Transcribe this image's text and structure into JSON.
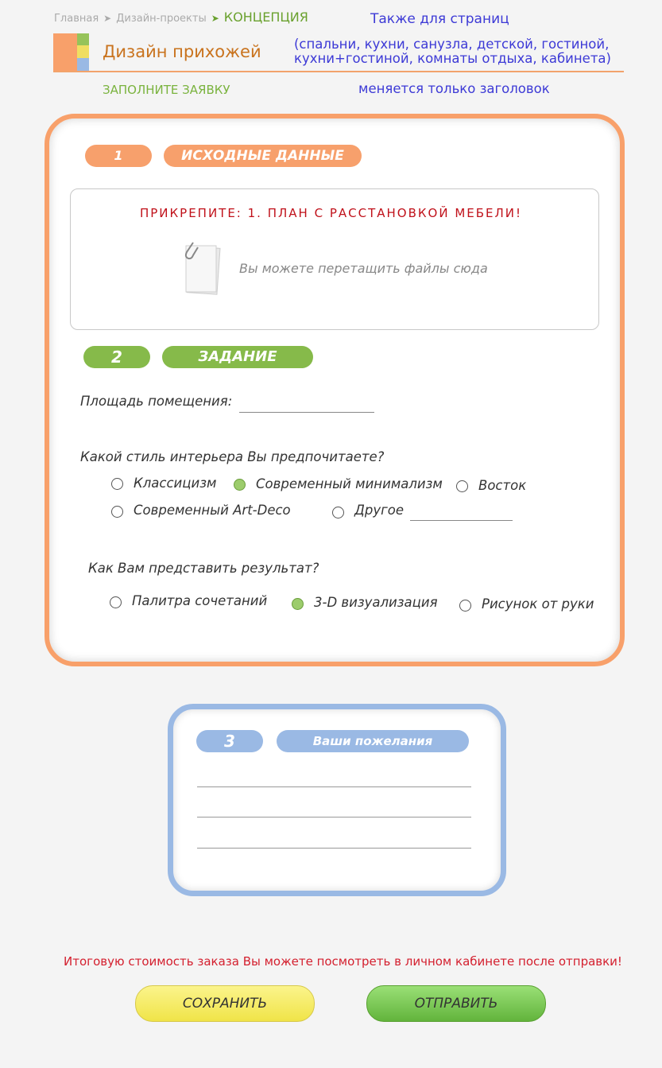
{
  "breadcrumb": {
    "home": "Главная",
    "projects": "Дизайн-проекты",
    "current": "КОНЦЕПЦИЯ"
  },
  "header": {
    "also_for": "Также для страниц",
    "title": "Дизайн прихожей",
    "rooms_line1": "(спальни, кухни, санузла, детской, гостиной,",
    "rooms_line2": "кухни+гостиной, комнаты отдыха, кабинета)",
    "fill_request": "ЗАПОЛНИТЕ ЗАЯВКУ",
    "note": "меняется только заголовок"
  },
  "section1": {
    "number": "1",
    "title": "ИСХОДНЫЕ ДАННЫЕ",
    "attach_label": "ПРИКРЕПИТЕ: 1. ПЛАН С РАССТАНОВКОЙ МЕБЕЛИ!",
    "drop_text": "Вы можете перетащить файлы сюда"
  },
  "section2": {
    "number": "2",
    "title": "ЗАДАНИЕ",
    "area_label": "Площадь помещения:",
    "style_question": "Какой стиль интерьера Вы предпочитаете?",
    "style_options": [
      "Классицизм",
      "Современный минимализм",
      "Восток",
      "Современный Art-Deco",
      "Другое"
    ],
    "style_selected": "Современный минимализм",
    "result_question": "Как Вам представить результат?",
    "result_options": [
      "Палитра сочетаний",
      "3-D визуализация",
      "Рисунок от руки"
    ],
    "result_selected": "3-D визуализация"
  },
  "section3": {
    "number": "3",
    "title": "Ваши пожелания"
  },
  "footer": {
    "cost_note": "Итоговую стоимость заказа Вы можете посмотреть в личном кабинете после отправки!",
    "save_label": "СОХРАНИТЬ",
    "send_label": "ОТПРАВИТЬ"
  },
  "colors": {
    "orange": "#f8a06a",
    "green": "#86ba4a",
    "blue": "#9ab9e4",
    "red": "#d4202f"
  }
}
